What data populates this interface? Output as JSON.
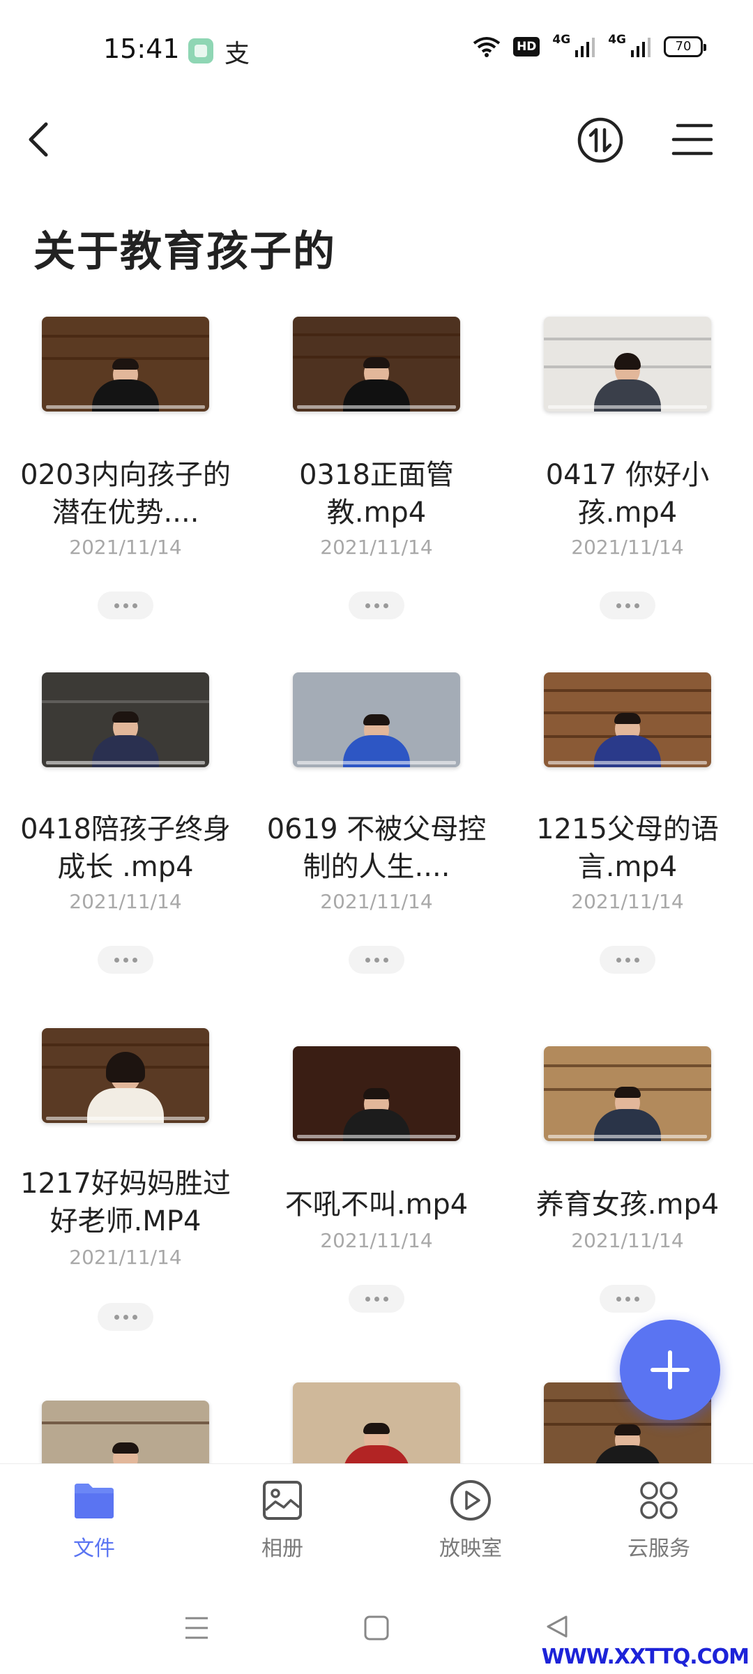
{
  "status_bar": {
    "time": "15:41",
    "alipay_glyph": "支",
    "hd_label": "HD",
    "signal1_label": "4G",
    "signal2_label": "4G",
    "battery": "70"
  },
  "header": {
    "title": "关于教育孩子的",
    "back_icon": "chevron-left-icon",
    "sort_icon": "sort-icon",
    "menu_icon": "menu-icon"
  },
  "files": [
    {
      "name": "0203内向孩子的潜在优势....",
      "date": "2021/11/14",
      "thumb_bg": "#5b3a22",
      "shirt": "#141414"
    },
    {
      "name": "0318正面管教.mp4",
      "date": "2021/11/14",
      "thumb_bg": "#4e3220",
      "shirt": "#111111"
    },
    {
      "name": "0417 你好小孩.mp4",
      "date": "2021/11/14",
      "thumb_bg": "#e8e6e2",
      "shirt": "#3a3f4a"
    },
    {
      "name": "0418陪孩子终身成长 .mp4",
      "date": "2021/11/14",
      "thumb_bg": "#3c3a36",
      "shirt": "#2a3050"
    },
    {
      "name": "0619 不被父母控制的人生....",
      "date": "2021/11/14",
      "thumb_bg": "#a4acb6",
      "shirt": "#2d56c4"
    },
    {
      "name": "1215父母的语言.mp4",
      "date": "2021/11/14",
      "thumb_bg": "#8a5a36",
      "shirt": "#2a3a8a"
    },
    {
      "name": "1217好妈妈胜过好老师.MP4",
      "date": "2021/11/14",
      "thumb_bg": "#5a3a24",
      "shirt": "#f2ede4"
    },
    {
      "name": "不吼不叫.mp4",
      "date": "2021/11/14",
      "thumb_bg": "#3a1e14",
      "shirt": "#1c1c1c"
    },
    {
      "name": "养育女孩.mp4",
      "date": "2021/11/14",
      "thumb_bg": "#b28a5c",
      "shirt": "#2a3448"
    },
    {
      "name": "",
      "date": "",
      "thumb_bg": "#b8a890",
      "shirt": "#c42a2a"
    },
    {
      "name": "",
      "date": "",
      "thumb_bg": "#cfb89a",
      "shirt": "#b22424"
    },
    {
      "name": "",
      "date": "",
      "thumb_bg": "#7a5434",
      "shirt": "#1a1a1a"
    }
  ],
  "fab": {
    "icon": "plus-icon"
  },
  "bottom_nav": [
    {
      "label": "文件",
      "icon": "folder-icon",
      "active": true
    },
    {
      "label": "相册",
      "icon": "album-icon",
      "active": false
    },
    {
      "label": "放映室",
      "icon": "play-icon",
      "active": false
    },
    {
      "label": "云服务",
      "icon": "grid-icon",
      "active": false
    }
  ],
  "watermark": "WWW.XXTTQ.COM",
  "colors": {
    "accent": "#5a74f2",
    "date_gray": "#a8a8a8"
  }
}
